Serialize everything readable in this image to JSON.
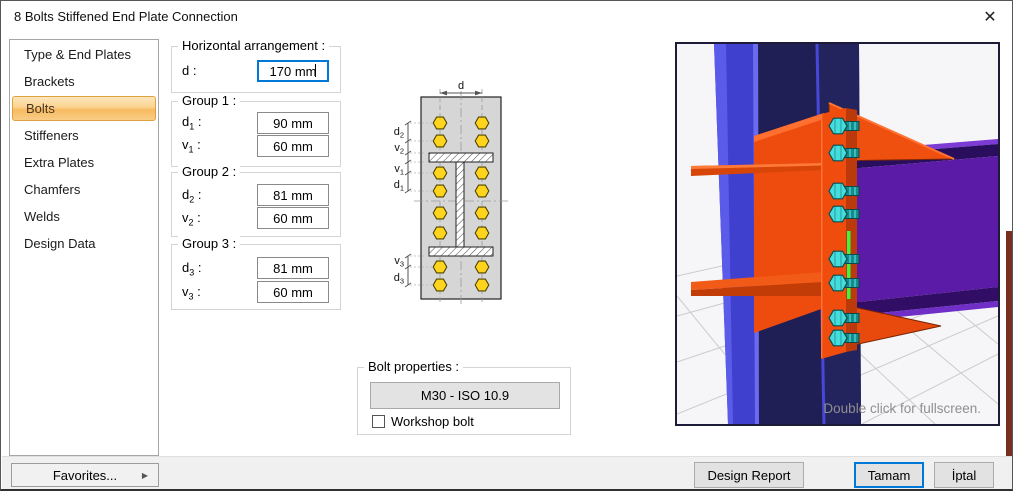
{
  "window": {
    "title": "8 Bolts Stiffened End Plate Connection"
  },
  "icons": {
    "close": "✕",
    "favorites_arrow": "▶"
  },
  "sidebar": {
    "items": [
      {
        "label": "Type & End Plates",
        "selected": false
      },
      {
        "label": "Brackets",
        "selected": false
      },
      {
        "label": "Bolts",
        "selected": true
      },
      {
        "label": "Stiffeners",
        "selected": false
      },
      {
        "label": "Extra Plates",
        "selected": false
      },
      {
        "label": "Chamfers",
        "selected": false
      },
      {
        "label": "Welds",
        "selected": false
      },
      {
        "label": "Design Data",
        "selected": false
      }
    ]
  },
  "groups": [
    {
      "title": "Horizontal arrangement :",
      "rows": [
        {
          "base": "d",
          "sub": "",
          "suffix": " :",
          "value": "170 mm",
          "focused": true
        }
      ]
    },
    {
      "title": "Group 1 :",
      "rows": [
        {
          "base": "d",
          "sub": "1",
          "suffix": " :",
          "value": "90 mm",
          "focused": false
        },
        {
          "base": "v",
          "sub": "1",
          "suffix": " :",
          "value": "60 mm",
          "focused": false
        }
      ]
    },
    {
      "title": "Group 2 :",
      "rows": [
        {
          "base": "d",
          "sub": "2",
          "suffix": " :",
          "value": "81 mm",
          "focused": false
        },
        {
          "base": "v",
          "sub": "2",
          "suffix": " :",
          "value": "60 mm",
          "focused": false
        }
      ]
    },
    {
      "title": "Group 3 :",
      "rows": [
        {
          "base": "d",
          "sub": "3",
          "suffix": " :",
          "value": "81 mm",
          "focused": false
        },
        {
          "base": "v",
          "sub": "3",
          "suffix": " :",
          "value": "60 mm",
          "focused": false
        }
      ]
    }
  ],
  "diagram": {
    "top_label": "d",
    "side_labels": [
      {
        "base": "d",
        "sub": "2"
      },
      {
        "base": "v",
        "sub": "2"
      },
      {
        "base": "v",
        "sub": "1"
      },
      {
        "base": "d",
        "sub": "1"
      },
      {
        "base": "v",
        "sub": "3"
      },
      {
        "base": "d",
        "sub": "3"
      }
    ]
  },
  "bolt_properties": {
    "title": "Bolt properties :",
    "button_label": "M30 - ISO 10.9",
    "checkbox_label": "Workshop bolt",
    "checkbox_checked": false
  },
  "viewer": {
    "hint": "Double click for fullscreen."
  },
  "footer": {
    "favorites": "Favorites...",
    "design_report": "Design Report",
    "ok": "Tamam",
    "cancel": "İptal"
  },
  "colors": {
    "selection_border": "#dfa03f",
    "selection_fill_top": "#fde7bd",
    "selection_fill_bottom": "#f9cd86",
    "focus_blue": "#0078d7",
    "bolt_yellow": "#ffd41c",
    "steel_orange": "#f04c0e",
    "steel_blue": "#4545d8",
    "steel_navy": "#1f1f55",
    "steel_purple": "#5b1ba6",
    "bolt_teal": "#45dede",
    "footer_gray": "#f0f0f0"
  }
}
